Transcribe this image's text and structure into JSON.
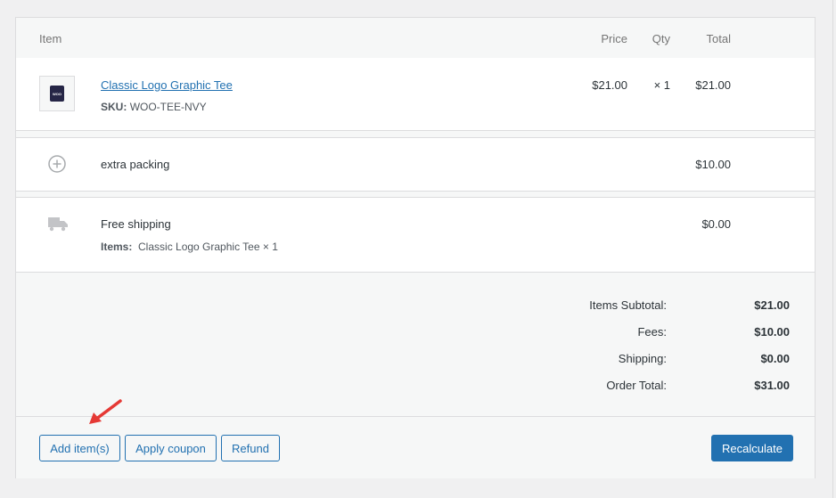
{
  "table": {
    "headers": {
      "item": "Item",
      "price": "Price",
      "qty": "Qty",
      "total": "Total"
    }
  },
  "line_item": {
    "thumb_text": "WOO",
    "name": "Classic Logo Graphic Tee",
    "sku_label": "SKU:",
    "sku_value": "WOO-TEE-NVY",
    "price": "$21.00",
    "qty": "× 1",
    "total": "$21.00"
  },
  "fee": {
    "name": "extra packing",
    "total": "$10.00"
  },
  "shipping": {
    "name": "Free shipping",
    "items_label": "Items:",
    "items_value": "Classic Logo Graphic Tee × 1",
    "total": "$0.00"
  },
  "totals": {
    "subtotal_label": "Items Subtotal:",
    "subtotal_value": "$21.00",
    "fees_label": "Fees:",
    "fees_value": "$10.00",
    "shipping_label": "Shipping:",
    "shipping_value": "$0.00",
    "order_total_label": "Order Total:",
    "order_total_value": "$31.00"
  },
  "actions": {
    "add_items": "Add item(s)",
    "apply_coupon": "Apply coupon",
    "refund": "Refund",
    "recalculate": "Recalculate"
  },
  "colors": {
    "accent": "#2271b1",
    "arrow": "#e53935",
    "border": "#dcdcde"
  }
}
